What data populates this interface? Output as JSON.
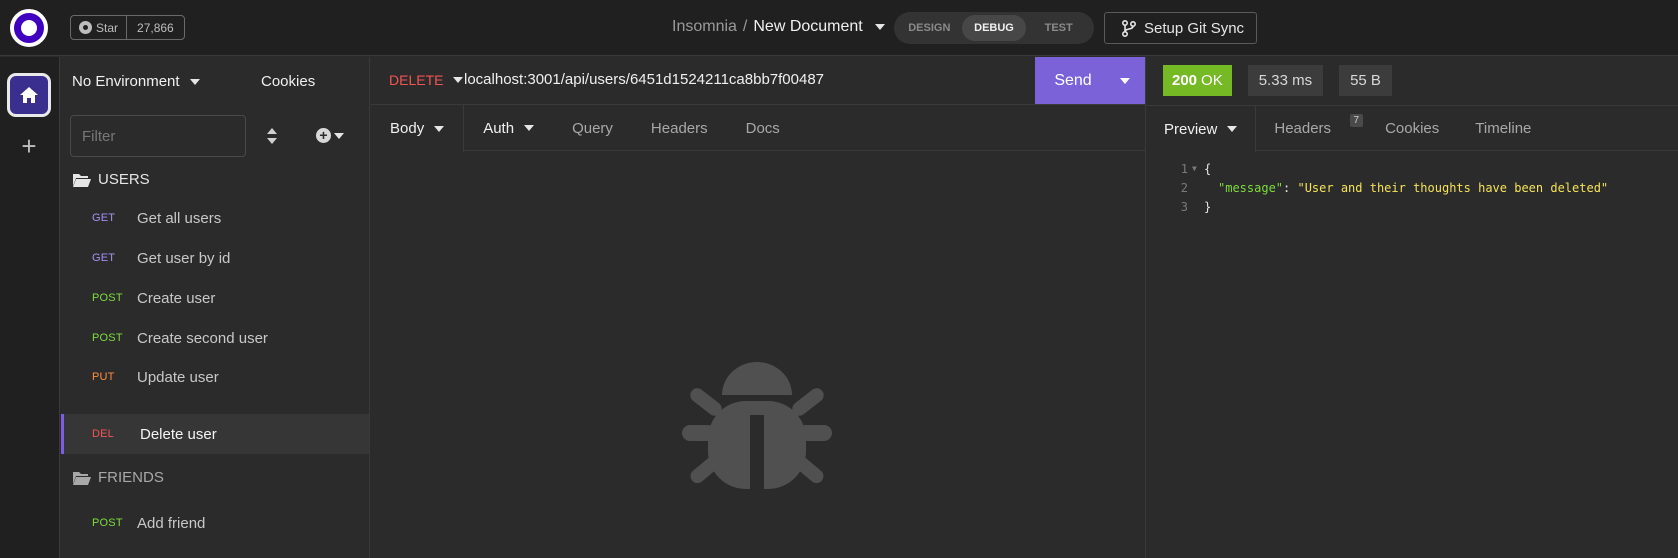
{
  "topbar": {
    "github": {
      "star_label": "Star",
      "star_count": "27,866"
    },
    "breadcrumb": {
      "project": "Insomnia",
      "separator": "/",
      "document": "New Document"
    },
    "modes": [
      {
        "label": "DESIGN",
        "active": false
      },
      {
        "label": "DEBUG",
        "active": true
      },
      {
        "label": "TEST",
        "active": false
      }
    ],
    "git_sync_label": "Setup Git Sync"
  },
  "sidebar": {
    "environment": "No Environment",
    "cookies_label": "Cookies",
    "filter_placeholder": "Filter",
    "folders": [
      {
        "name": "USERS",
        "requests": [
          {
            "method": "GET",
            "name": "Get all users",
            "active": false
          },
          {
            "method": "GET",
            "name": "Get user by id",
            "active": false
          },
          {
            "method": "POST",
            "name": "Create user",
            "active": false
          },
          {
            "method": "POST",
            "name": "Create second user",
            "active": false
          },
          {
            "method": "PUT",
            "name": "Update user",
            "active": false
          },
          {
            "method": "DEL",
            "name": "Delete user",
            "active": true
          }
        ]
      },
      {
        "name": "FRIENDS",
        "requests": [
          {
            "method": "POST",
            "name": "Add friend",
            "active": false
          }
        ]
      }
    ]
  },
  "request": {
    "method": "DELETE",
    "url": "localhost:3001/api/users/6451d1524211ca8bb7f00487",
    "send_label": "Send",
    "tabs": [
      "Body",
      "Auth",
      "Query",
      "Headers",
      "Docs"
    ]
  },
  "response": {
    "status_code": "200",
    "status_text": "OK",
    "time": "5.33 ms",
    "size": "55 B",
    "tabs": [
      "Preview",
      "Headers",
      "Cookies",
      "Timeline"
    ],
    "headers_count": "7",
    "body_lines": [
      {
        "n": "1",
        "open": "{"
      },
      {
        "n": "2",
        "key": "\"message\"",
        "colon": ": ",
        "value": "\"User and their thoughts have been deleted\""
      },
      {
        "n": "3",
        "close": "}"
      }
    ]
  },
  "colors": {
    "accent": "#7c62d9",
    "get": "#a490f3",
    "post": "#7ddc3e",
    "put": "#ff8f3f",
    "delete": "#f25454",
    "status_ok": "#75ba24"
  }
}
